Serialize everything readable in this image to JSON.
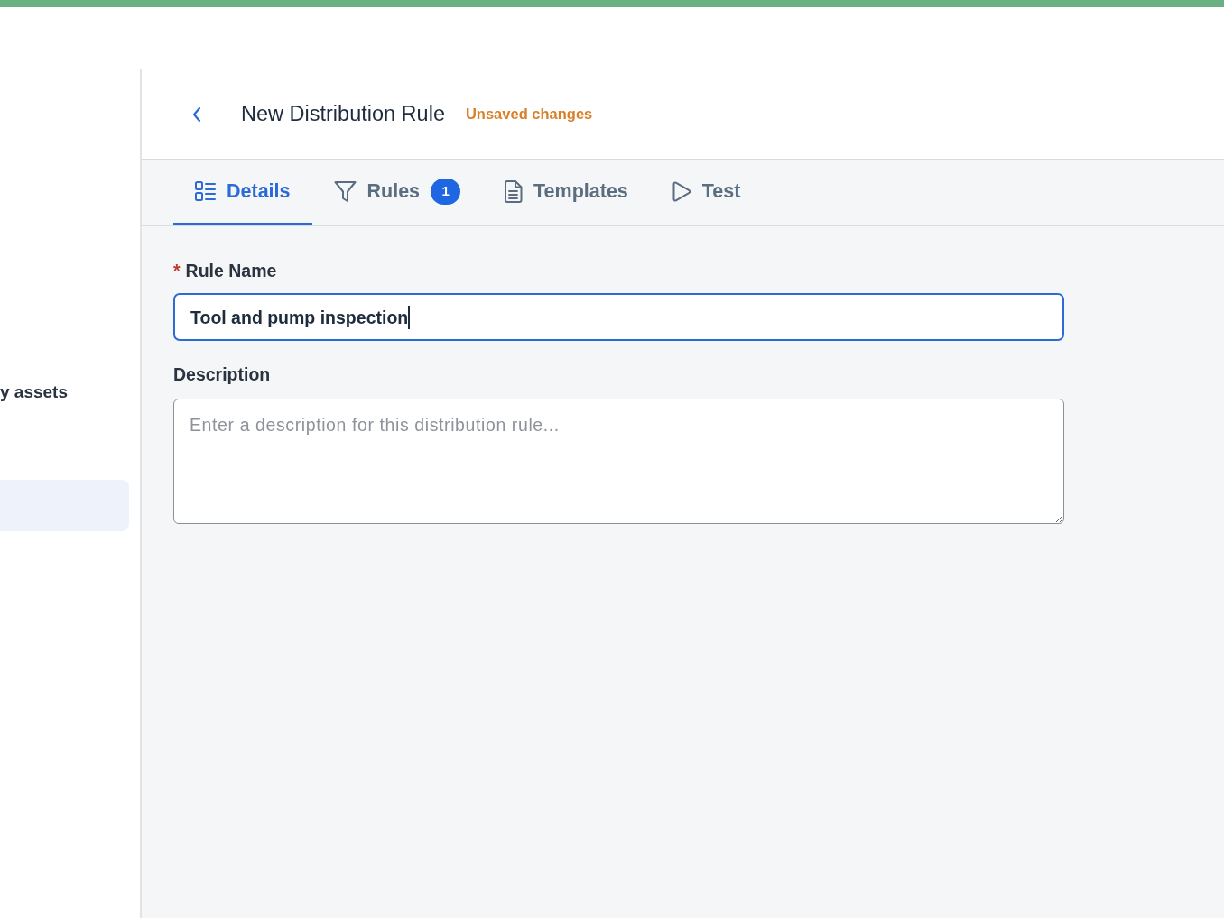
{
  "sidebar": {
    "items": [
      {
        "label": "y assets",
        "selected": false
      },
      {
        "selected": true
      }
    ]
  },
  "header": {
    "title": "New Distribution Rule",
    "status": "Unsaved changes"
  },
  "tabs": [
    {
      "label": "Details",
      "selected": true
    },
    {
      "label": "Rules",
      "badge": "1",
      "selected": false
    },
    {
      "label": "Templates",
      "selected": false
    },
    {
      "label": "Test",
      "selected": false
    }
  ],
  "form": {
    "fields": [
      {
        "kind": "text",
        "required_mark": "*",
        "label": "Rule Name",
        "value": "Tool and pump inspection",
        "focused": true
      },
      {
        "kind": "textarea",
        "label": "Description",
        "placeholder": "Enter a description for this distribution rule..."
      }
    ]
  }
}
